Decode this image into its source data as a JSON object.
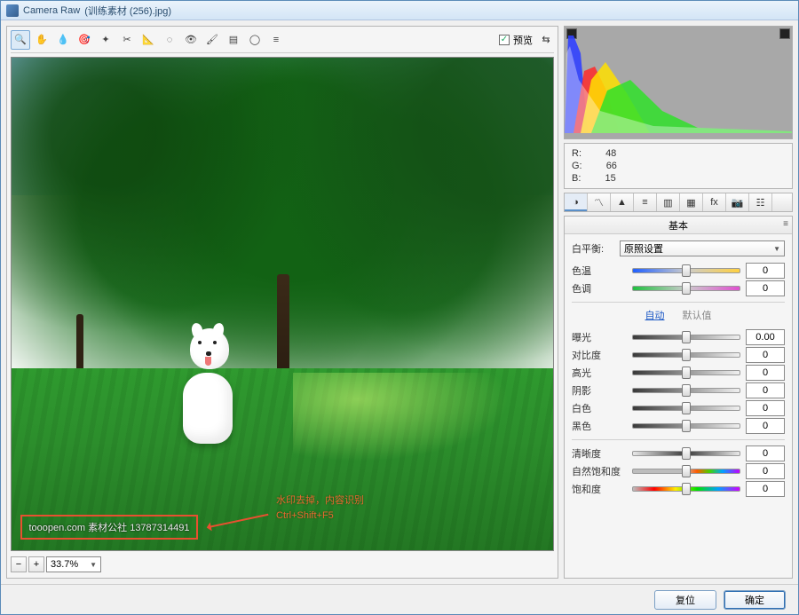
{
  "window": {
    "app_name": "Camera Raw",
    "file_name": "(训练素材 (256).jpg)"
  },
  "toolbar": {
    "tools": [
      {
        "name": "zoom-tool",
        "glyph": "🔍"
      },
      {
        "name": "hand-tool",
        "glyph": "✋"
      },
      {
        "name": "white-balance-tool",
        "glyph": "💧"
      },
      {
        "name": "color-sampler-tool",
        "glyph": "🎯"
      },
      {
        "name": "target-adjustment-tool",
        "glyph": "✦"
      },
      {
        "name": "crop-tool",
        "glyph": "✂"
      },
      {
        "name": "straighten-tool",
        "glyph": "📐"
      },
      {
        "name": "spot-removal-tool",
        "glyph": "◌"
      },
      {
        "name": "red-eye-tool",
        "glyph": "👁"
      },
      {
        "name": "adjustment-brush-tool",
        "glyph": "🖌"
      },
      {
        "name": "graduated-filter-tool",
        "glyph": "▤"
      },
      {
        "name": "radial-filter-tool",
        "glyph": "◯"
      },
      {
        "name": "prefs-tool",
        "glyph": "≡"
      }
    ],
    "preview_label": "预览",
    "preview_checked": true
  },
  "image": {
    "watermark_text": "tooopen.com 素材公社 13787314491",
    "annotation_line1": "水印去掉，内容识别",
    "annotation_line2": "Ctrl+Shift+F5"
  },
  "zoom": {
    "value": "33.7%"
  },
  "readout": {
    "r_label": "R:",
    "r_value": "48",
    "g_label": "G:",
    "g_value": "66",
    "b_label": "B:",
    "b_value": "15"
  },
  "tabs": [
    {
      "name": "basic-tab",
      "glyph": "◑"
    },
    {
      "name": "curve-tab",
      "glyph": "〽"
    },
    {
      "name": "detail-tab",
      "glyph": "▲"
    },
    {
      "name": "hsl-tab",
      "glyph": "≡"
    },
    {
      "name": "split-tab",
      "glyph": "▥"
    },
    {
      "name": "lens-tab",
      "glyph": "▦"
    },
    {
      "name": "fx-tab",
      "glyph": "fx"
    },
    {
      "name": "camera-tab",
      "glyph": "📷"
    },
    {
      "name": "presets-tab",
      "glyph": "☷"
    }
  ],
  "panel": {
    "title": "基本",
    "wb_label": "白平衡:",
    "wb_value": "原照设置",
    "auto_link": "自动",
    "default_link": "默认值",
    "sliders": {
      "temperature": {
        "label": "色温",
        "value": "0",
        "pos": 50
      },
      "tint": {
        "label": "色调",
        "value": "0",
        "pos": 50
      },
      "exposure": {
        "label": "曝光",
        "value": "0.00",
        "pos": 50
      },
      "contrast": {
        "label": "对比度",
        "value": "0",
        "pos": 50
      },
      "highlights": {
        "label": "高光",
        "value": "0",
        "pos": 50
      },
      "shadows": {
        "label": "阴影",
        "value": "0",
        "pos": 50
      },
      "whites": {
        "label": "白色",
        "value": "0",
        "pos": 50
      },
      "blacks": {
        "label": "黑色",
        "value": "0",
        "pos": 50
      },
      "clarity": {
        "label": "清晰度",
        "value": "0",
        "pos": 50
      },
      "vibrance": {
        "label": "自然饱和度",
        "value": "0",
        "pos": 50
      },
      "saturation": {
        "label": "饱和度",
        "value": "0",
        "pos": 50
      }
    }
  },
  "footer": {
    "reset": "复位",
    "ok": "确定"
  }
}
